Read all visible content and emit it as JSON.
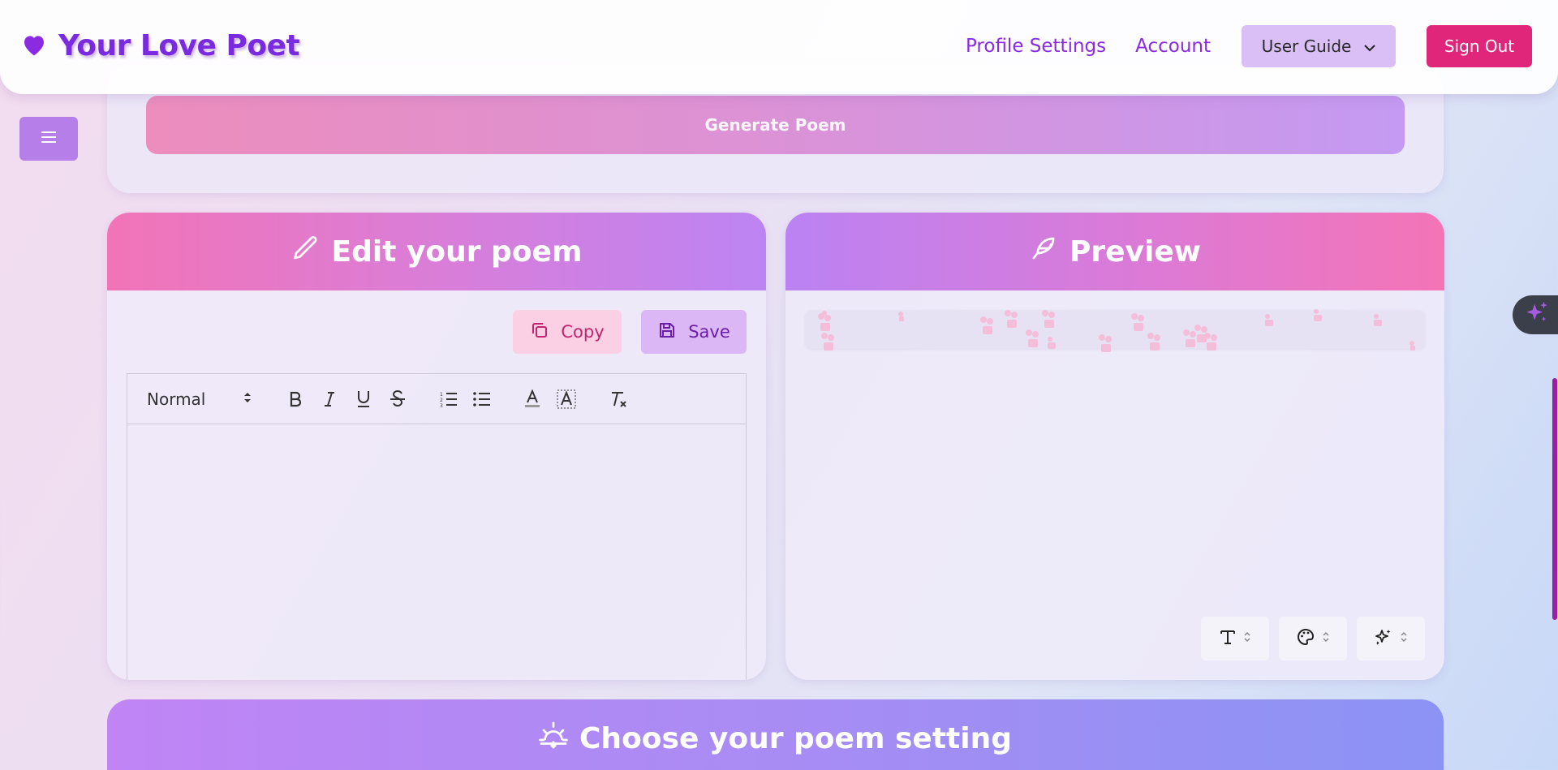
{
  "nav": {
    "brand": "Your Love Poet",
    "links": [
      "Profile Settings",
      "Account"
    ],
    "guide_label": "User Guide",
    "signout_label": "Sign Out"
  },
  "generate": {
    "label": "Generate Poem"
  },
  "editor": {
    "title": "Edit your poem",
    "copy_label": "Copy",
    "save_label": "Save",
    "format_value": "Normal",
    "content": ""
  },
  "preview": {
    "title": "Preview"
  },
  "setting": {
    "title": "Choose your poem setting"
  },
  "colors": {
    "accent": "#8a2be2",
    "signout": "#e0267a",
    "scroll": "#9b1fa0"
  },
  "icons": {
    "brand": "heart-icon",
    "menu": "hamburger-icon",
    "edit": "pencil-icon",
    "preview": "feather-icon",
    "setting": "sunrise-icon",
    "copy": "copy-icon",
    "save": "floppy-icon",
    "ai": "sparkles-icon"
  }
}
